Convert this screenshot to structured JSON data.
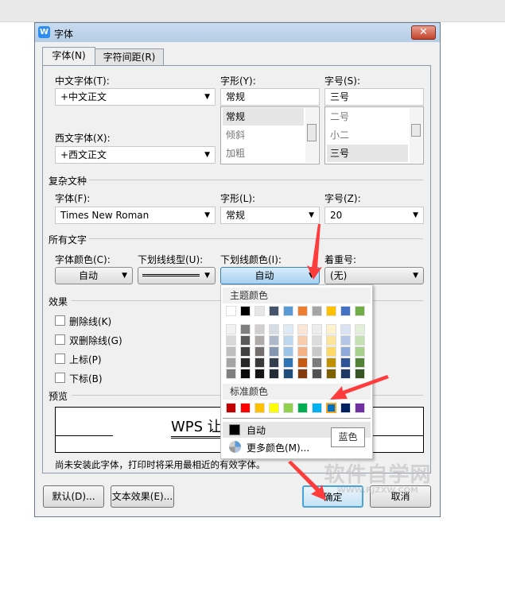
{
  "window": {
    "title": "字体",
    "app_icon": "W",
    "close": "✕"
  },
  "tabs": [
    {
      "label": "字体(N)"
    },
    {
      "label": "字符间距(R)"
    }
  ],
  "chinese_font": {
    "label": "中文字体(T):",
    "value": "+中文正文"
  },
  "western_font": {
    "label": "西文字体(X):",
    "value": "+西文正文"
  },
  "style": {
    "label": "字形(Y):",
    "value": "常规",
    "options": [
      "常规",
      "倾斜",
      "加粗"
    ]
  },
  "size": {
    "label": "字号(S):",
    "value": "三号",
    "options": [
      "二号",
      "小二",
      "三号"
    ]
  },
  "complex": {
    "section": "复杂文种",
    "font_label": "字体(F):",
    "font_value": "Times New Roman",
    "style_label": "字形(L):",
    "style_value": "常规",
    "size_label": "字号(Z):",
    "size_value": "20"
  },
  "all_text": {
    "section": "所有文字",
    "color_label": "字体颜色(C):",
    "color_value": "自动",
    "underline_label": "下划线线型(U):",
    "underline_color_label": "下划线颜色(I):",
    "underline_color_value": "自动",
    "emphasis_label": "着重号:",
    "emphasis_value": "(无)"
  },
  "effects": {
    "section": "效果",
    "items": [
      "删除线(K)",
      "双删除线(G)",
      "上标(P)",
      "下标(B)"
    ]
  },
  "preview": {
    "section": "预览",
    "text": "WPS 让"
  },
  "note": "尚未安装此字体，打印时将采用最相近的有效字体。",
  "buttons": {
    "default": "默认(D)...",
    "text_effects": "文本效果(E)...",
    "ok": "确定",
    "cancel": "取消"
  },
  "palette": {
    "theme_title": "主题颜色",
    "theme": [
      "#ffffff",
      "#000000",
      "#e7e6e6",
      "#44546a",
      "#5b9bd5",
      "#ed7d31",
      "#a5a5a5",
      "#ffc000",
      "#4472c4",
      "#70ad47"
    ],
    "shades": [
      [
        "#f2f2f2",
        "#7f7f7f",
        "#d0cece",
        "#d6dce4",
        "#deebf6",
        "#fbe5d5",
        "#ededed",
        "#fff2cc",
        "#dae3f3",
        "#e2efd9"
      ],
      [
        "#d8d8d8",
        "#595959",
        "#aeaaaa",
        "#adb9ca",
        "#bdd7ee",
        "#f7cbac",
        "#dbdbdb",
        "#fee599",
        "#b4c6e7",
        "#c5e0b3"
      ],
      [
        "#bfbfbf",
        "#3f3f3f",
        "#757070",
        "#8496b0",
        "#9dc3e6",
        "#f4b183",
        "#c9c9c9",
        "#ffd965",
        "#8eaadb",
        "#a8d08d"
      ],
      [
        "#a5a5a5",
        "#262626",
        "#3a3838",
        "#323f4f",
        "#2e75b5",
        "#c55a11",
        "#7b7b7b",
        "#bf9000",
        "#2f5496",
        "#538135"
      ],
      [
        "#7f7f7f",
        "#0c0c0c",
        "#171616",
        "#222a35",
        "#1e4e79",
        "#833c0b",
        "#525252",
        "#7f6000",
        "#1f3864",
        "#375623"
      ]
    ],
    "standard_title": "标准颜色",
    "standard": [
      "#c00000",
      "#ff0000",
      "#ffc000",
      "#ffff00",
      "#92d050",
      "#00b050",
      "#00b0f0",
      "#0070c0",
      "#002060",
      "#7030a0"
    ],
    "selected_index": 7,
    "auto_label": "自动",
    "more_label": "更多颜色(M)...",
    "tooltip": "蓝色"
  },
  "watermark": "软件自学网 WWW.RJZXW.COM",
  "accent": "#ff3b3b"
}
